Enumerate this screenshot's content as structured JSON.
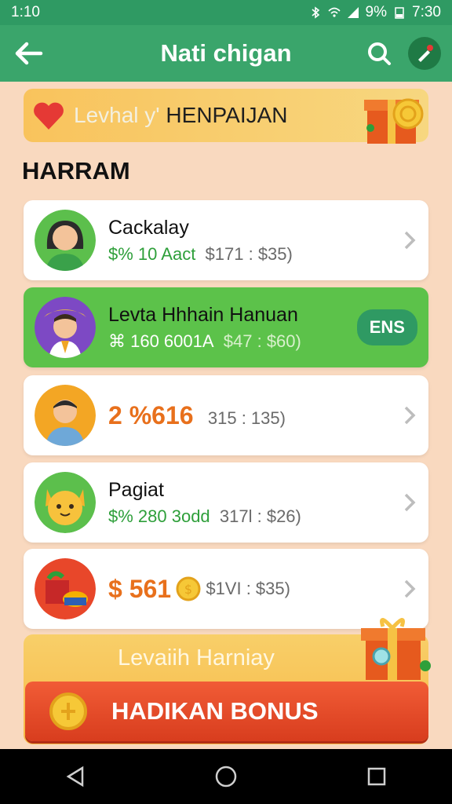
{
  "status_bar": {
    "time": "1:10",
    "battery": "9%",
    "clock": "7:30"
  },
  "app_bar": {
    "title": "Nati chigan"
  },
  "promo_banner": {
    "text_light": "Levhal y'",
    "text_dark": "HENPAIJAN"
  },
  "section": {
    "title": "HARRAM"
  },
  "cards": [
    {
      "name": "Cackalay",
      "amount": "$% 10 Aact",
      "range": "$171 : $35)"
    },
    {
      "name": "Levta Hhhain Hanuan",
      "amount": "⌘ 160 6001A",
      "range": "$47 : $60)",
      "badge": "ENS"
    },
    {
      "name": "",
      "amount": "2 %616",
      "range": "315 : 135)"
    },
    {
      "name": "Pagiat",
      "amount": "$% 280 3odd",
      "range": "317l : $26)"
    },
    {
      "name": "",
      "amount": "$ 561",
      "range": "$1VI : $35)"
    }
  ],
  "bottom_banner": {
    "text": "Levaiih Harniay",
    "button_label": "HADIKAN BONUS"
  },
  "colors": {
    "primary": "#3aa56b",
    "accent": "#e8701c",
    "active_card": "#5cc24a",
    "bonus": "#e2482a"
  },
  "icons": [
    "back-arrow-icon",
    "search-icon",
    "pen-icon",
    "heart-icon",
    "gift-icon",
    "chevron-right-icon",
    "coin-icon",
    "nav-back-icon",
    "nav-home-icon",
    "nav-recents-icon"
  ]
}
